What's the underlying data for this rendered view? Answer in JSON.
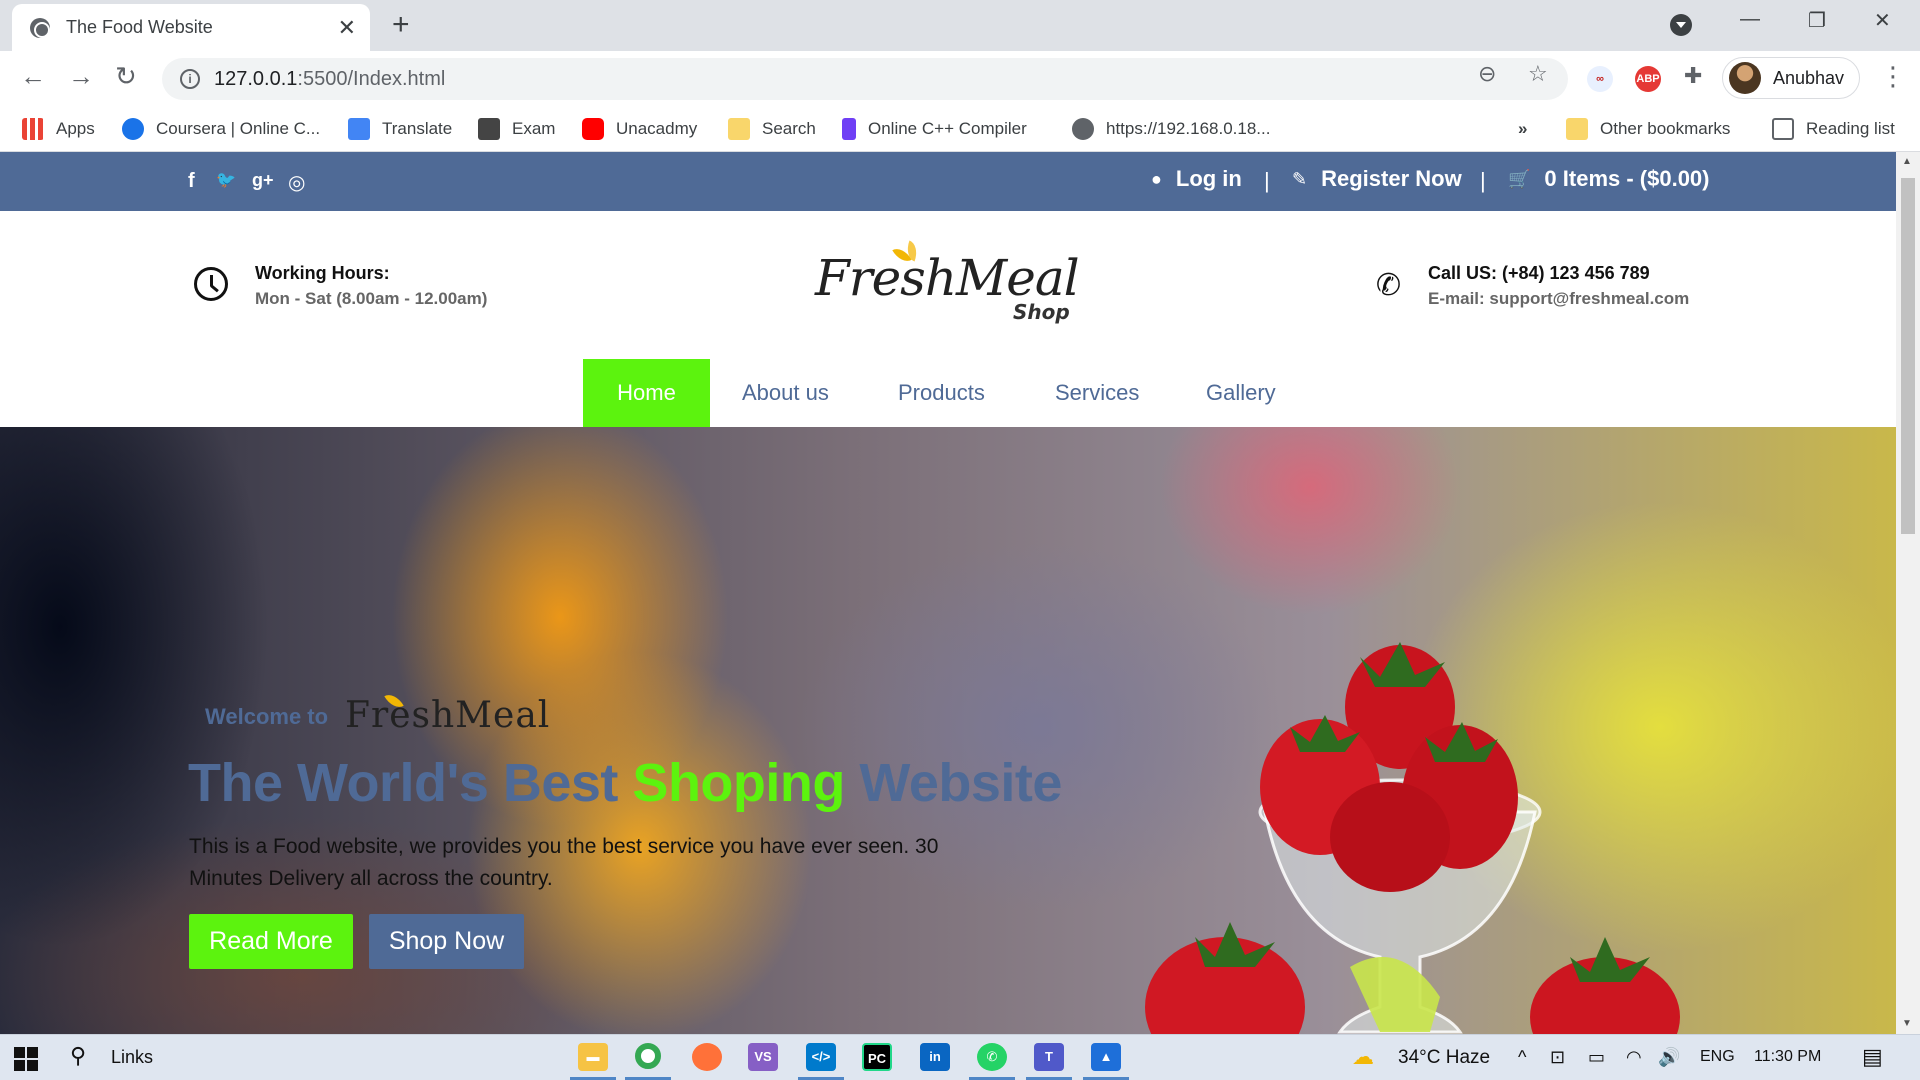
{
  "browser": {
    "tab_title": "The Food Website",
    "url_host": "127.0.0.1",
    "url_rest": ":5500/Index.html",
    "profile_name": "Anubhav",
    "bookmarks": [
      {
        "label": "Apps",
        "icon": "apps-grid-icon",
        "color": "#4285f4"
      },
      {
        "label": "Coursera | Online C...",
        "icon": "coursera-icon",
        "color": "#1a73e8"
      },
      {
        "label": "Translate",
        "icon": "translate-icon",
        "color": "#4285f4"
      },
      {
        "label": "Exam",
        "icon": "exam-icon",
        "color": "#444444"
      },
      {
        "label": "Unacadmy",
        "icon": "youtube-icon",
        "color": "#ff0000"
      },
      {
        "label": "Search",
        "icon": "folder-icon",
        "color": "#f9d66b"
      },
      {
        "label": "Online C++ Compiler",
        "icon": "compiler-icon",
        "color": "#6f3ff5"
      },
      {
        "label": "https://192.168.0.18...",
        "icon": "globe-icon",
        "color": "#5f6368"
      }
    ],
    "overflow_label": "»",
    "other_bookmarks": "Other bookmarks",
    "reading_list": "Reading list"
  },
  "site": {
    "topbar": {
      "social": [
        "f",
        "🐦",
        "g+",
        "◎"
      ],
      "login": "Log in",
      "register": "Register Now",
      "cart": "0 Items - ($0.00)",
      "separator": "|"
    },
    "info": {
      "hours_title": "Working Hours:",
      "hours_value": "Mon - Sat (8.00am - 12.00am)",
      "call_title": "Call US: (+84) 123 456 789",
      "email": "E-mail: support@freshmeal.com"
    },
    "logo": {
      "main": "FreshMeal",
      "sub": "Shop"
    },
    "nav": [
      "Home",
      "About us",
      "Products",
      "Services",
      "Gallery"
    ],
    "hero": {
      "welcome": "Welcome to",
      "brand": "FreshMeal",
      "headline_part1": "The World's Best ",
      "headline_green": "Shoping",
      "headline_part2": " Website",
      "paragraph": "This is a Food website, we provides you the best service you have ever seen. 30 Minutes Delivery all across the country.",
      "btn_read": "Read More",
      "btn_shop": "Shop Now"
    },
    "colors": {
      "brand_blue": "#4f6a96",
      "brand_green": "#5cf30e"
    }
  },
  "taskbar": {
    "search_label": "Links",
    "weather": "34°C  Haze",
    "language": "ENG",
    "time": "11:30 PM"
  }
}
